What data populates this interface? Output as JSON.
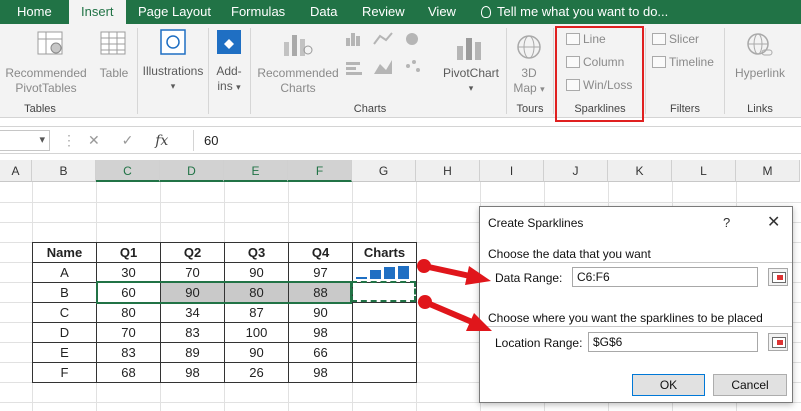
{
  "menu": {
    "tabs": [
      "Home",
      "Insert",
      "Page Layout",
      "Formulas",
      "Data",
      "Review",
      "View"
    ],
    "tell_me": "Tell me what you want to do..."
  },
  "ribbon": {
    "recommended_pivot": [
      "Recommended",
      "PivotTables"
    ],
    "table": "Table",
    "illustrations": "Illustrations",
    "addins": [
      "Add-",
      "ins"
    ],
    "recommended_charts": [
      "Recommended",
      "Charts"
    ],
    "pivotchart": "PivotChart",
    "map3d": [
      "3D",
      "Map"
    ],
    "sparklines": [
      "Line",
      "Column",
      "Win/Loss"
    ],
    "slicer": "Slicer",
    "timeline": "Timeline",
    "hyperlink": "Hyperlink",
    "groups": {
      "tables": "Tables",
      "charts": "Charts",
      "tours": "Tours",
      "sparklines": "Sparklines",
      "filters": "Filters",
      "links": "Links"
    }
  },
  "formula_bar": {
    "name_box": "",
    "fx": "fx",
    "value": "60"
  },
  "columns": [
    "A",
    "B",
    "C",
    "D",
    "E",
    "F",
    "G",
    "H",
    "I",
    "J",
    "K",
    "L",
    "M"
  ],
  "table": {
    "headers": [
      "Name",
      "Q1",
      "Q2",
      "Q3",
      "Q4",
      "Charts"
    ],
    "rows": [
      [
        "A",
        "30",
        "70",
        "90",
        "97"
      ],
      [
        "B",
        "60",
        "90",
        "80",
        "88"
      ],
      [
        "C",
        "80",
        "34",
        "87",
        "90"
      ],
      [
        "D",
        "70",
        "83",
        "100",
        "98"
      ],
      [
        "E",
        "83",
        "89",
        "90",
        "66"
      ],
      [
        "F",
        "68",
        "98",
        "26",
        "98"
      ]
    ]
  },
  "sparkline_preview": {
    "values": [
      30,
      70,
      90,
      97
    ],
    "color": "#1f6fc3"
  },
  "dialog": {
    "title": "Create Sparklines",
    "help": "?",
    "close": "✕",
    "section1": "Choose the data that you want",
    "data_range_label": "Data Range:",
    "data_range_value": "C6:F6",
    "section2": "Choose where you want the sparklines to be placed",
    "location_label": "Location Range:",
    "location_value": "$G$6",
    "ok": "OK",
    "cancel": "Cancel"
  },
  "colors": {
    "excel_green": "#217346",
    "highlight_red": "#e02020",
    "arrow_red": "#e0161b"
  }
}
